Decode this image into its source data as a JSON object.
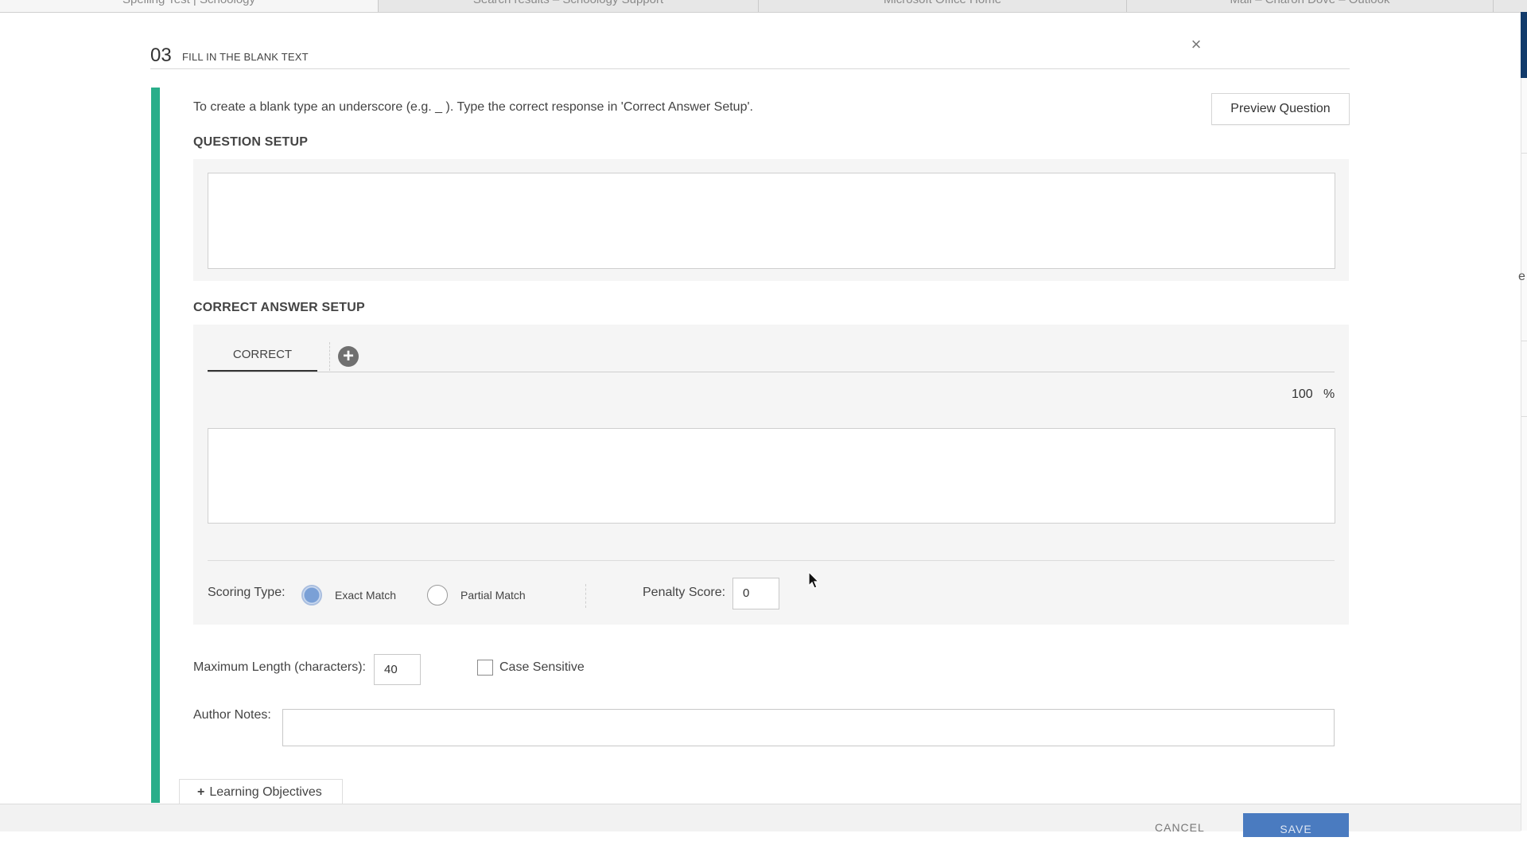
{
  "browser": {
    "tabs": [
      "Spelling Test | Schoology",
      "Search results – Schoology Support",
      "Microsoft Office Home",
      "Mail – Charon Dove – Outlook"
    ]
  },
  "modal": {
    "question_number": "03",
    "question_type": "FILL IN THE BLANK TEXT",
    "close_label": "×",
    "instructions": "To create a blank type an underscore (e.g. _ ). Type the correct response in 'Correct Answer Setup'.",
    "preview_button": "Preview Question",
    "question_setup_title": "QUESTION SETUP",
    "correct_answer_title": "CORRECT ANSWER SETUP",
    "answer_tabs": {
      "correct_label": "CORRECT",
      "add_label": "+"
    },
    "score_percent": "100",
    "percent_sign": "%",
    "scoring": {
      "label": "Scoring Type:",
      "options": [
        "Exact Match",
        "Partial Match"
      ],
      "selected": "Exact Match",
      "penalty_label": "Penalty Score:",
      "penalty_value": "0"
    },
    "max_length": {
      "label": "Maximum Length (characters):",
      "value": "40"
    },
    "case_sensitive": {
      "label": "Case Sensitive",
      "checked": false
    },
    "author_notes_label": "Author Notes:",
    "learning_objectives": "Learning Objectives",
    "footer": {
      "cancel": "CANCEL",
      "save": "SAVE"
    }
  },
  "right_edge_char": "e",
  "colors": {
    "accent_green": "#29ae8a",
    "save_blue": "#4a7bc0",
    "edge_navy": "#123b6b"
  }
}
